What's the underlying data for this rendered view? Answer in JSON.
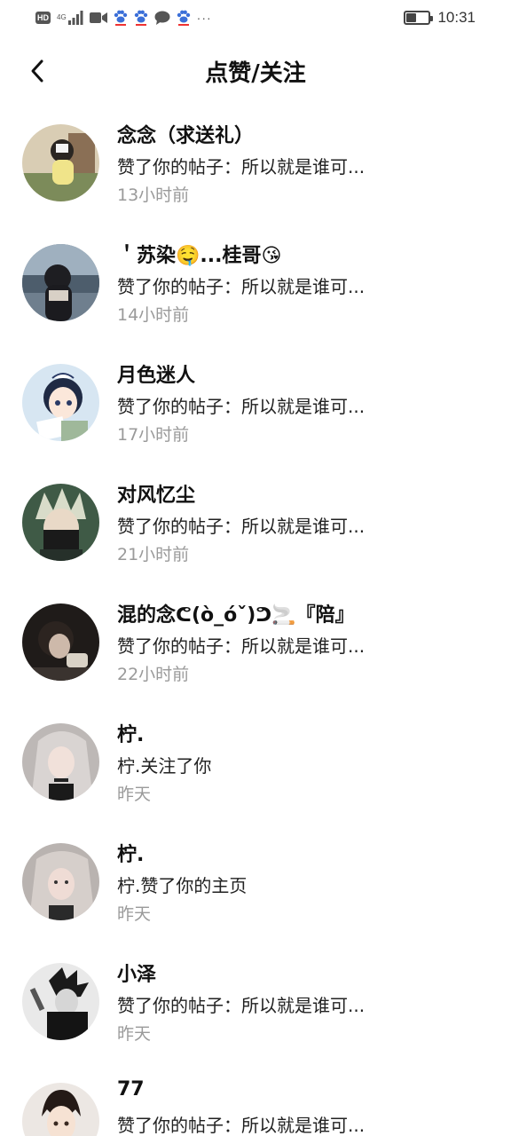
{
  "status_bar": {
    "hd": "HD",
    "network": "4G",
    "dots": "···",
    "time": "10:31",
    "battery_level": 0.45,
    "icons": [
      "hd-icon",
      "signal-icon",
      "video-icon",
      "paw-icon",
      "paw-icon",
      "chat-bubble-icon",
      "paw-icon",
      "more-dots-icon",
      "battery-icon"
    ]
  },
  "header": {
    "title": "点赞/关注",
    "back_icon": "chevron-left-icon"
  },
  "notifications": [
    {
      "name": "念念（求送礼）",
      "message": "赞了你的帖子：所以就是谁可...",
      "time": "13小时前",
      "avatar_color": "#c9b89e"
    },
    {
      "name": "＇苏染🤤...桂哥😘",
      "message": "赞了你的帖子：所以就是谁可...",
      "time": "14小时前",
      "avatar_color": "#6f7f8e"
    },
    {
      "name": "月色迷人",
      "message": "赞了你的帖子：所以就是谁可...",
      "time": "17小时前",
      "avatar_color": "#bcd4ea"
    },
    {
      "name": "对风忆尘",
      "message": "赞了你的帖子：所以就是谁可...",
      "time": "21小时前",
      "avatar_color": "#4e6b55"
    },
    {
      "name": "混的念ᕦ(ò_óˇ)ᕤ🚬『陪』",
      "message": "赞了你的帖子：所以就是谁可...",
      "time": "22小时前",
      "avatar_color": "#2e2a28"
    },
    {
      "name": "柠.",
      "message": "柠.关注了你",
      "time": "昨天",
      "avatar_color": "#d8d2cf"
    },
    {
      "name": "柠.",
      "message": "柠.赞了你的主页",
      "time": "昨天",
      "avatar_color": "#cfc8c4"
    },
    {
      "name": "小泽",
      "message": "赞了你的帖子：所以就是谁可...",
      "time": "昨天",
      "avatar_color": "#2a2a2a"
    },
    {
      "name": "77",
      "message": "赞了你的帖子：所以就是谁可...",
      "time": "",
      "avatar_color": "#e9e4df"
    }
  ]
}
